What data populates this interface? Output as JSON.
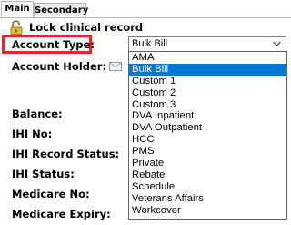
{
  "tabs": [
    {
      "label": "Main"
    },
    {
      "label": "Secondary"
    }
  ],
  "lock": {
    "label": "Lock clinical record"
  },
  "fields": {
    "account_type": "Account Type:",
    "account_holder": "Account Holder:",
    "balance": "Balance:",
    "ihi_no": "IHI No:",
    "ihi_record_status": "IHI Record Status:",
    "ihi_status": "IHI Status:",
    "medicare_no": "Medicare No:",
    "medicare_expiry": "Medicare Expiry:"
  },
  "account_type_select": {
    "value": "Bulk Bill",
    "options": [
      "AMA",
      "Bulk Bill",
      "Custom 1",
      "Custom 2",
      "Custom 3",
      "DVA Inpatient",
      "DVA Outpatient",
      "HCC",
      "PMS",
      "Private",
      "Rebate",
      "Schedule",
      "Veterans Affairs",
      "Workcover"
    ]
  },
  "colors": {
    "highlight": "#e5262a",
    "selection": "#0078d7"
  }
}
